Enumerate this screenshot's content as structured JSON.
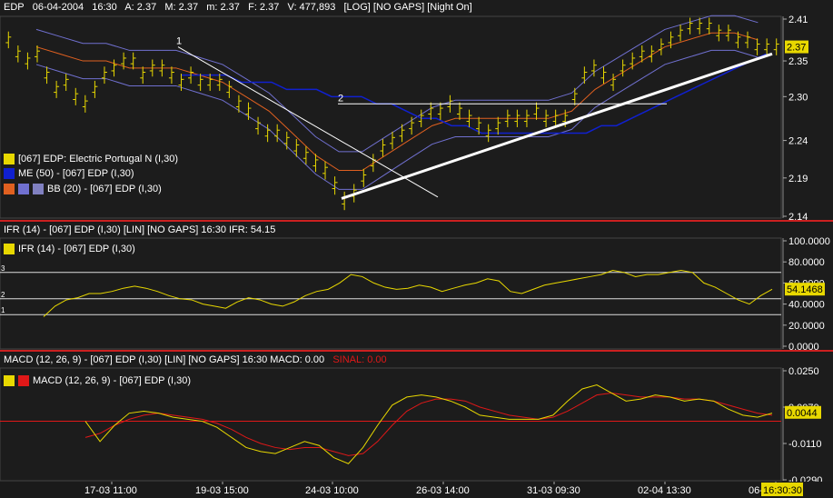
{
  "header": {
    "ticker": "EDP",
    "date": "06-04-2004",
    "time": "16:30",
    "a": "A: 2.37",
    "m": "M: 2.37",
    "min": "m: 2.37",
    "f": "F: 2.37",
    "v": "V: 477,893",
    "flags": "[LOG] [NO GAPS] [Night On]"
  },
  "price_pane": {
    "legend": [
      {
        "label": "[067] EDP: Electric Portugal N (I,30)",
        "colors": [
          "#e8d800"
        ]
      },
      {
        "label": "ME (50)  - [067] EDP (I,30)",
        "colors": [
          "#1020d0"
        ]
      },
      {
        "label": "BB (20)  - [067] EDP (I,30)",
        "colors": [
          "#e06020",
          "#7070d0",
          "#8080c0"
        ]
      }
    ],
    "trendline_labels": [
      "1",
      "2"
    ],
    "last_price_tag": "2.37"
  },
  "rsi_pane": {
    "header": "IFR (14)  - [067] EDP (I,30) [LIN] [NO GAPS]   16:30  IFR: 54.15",
    "legend": "IFR (14)  - [067] EDP (I,30)",
    "level_labels": [
      "3",
      "2",
      "1"
    ],
    "value_tag": "54.1468"
  },
  "macd_pane": {
    "header": "MACD (12, 26, 9)  - [067] EDP (I,30) [LIN] [NO GAPS]   16:30  MACD: 0.00",
    "signal_text": "SINAL: 0.00",
    "legend": "MACD (12, 26, 9)  - [067] EDP (I,30)",
    "value_tag": "0.0044"
  },
  "x_axis": {
    "labels": [
      "17-03 11:00",
      "19-03 15:00",
      "24-03 10:00",
      "26-03 14:00",
      "31-03 09:30",
      "02-04 13:30",
      "06-04"
    ],
    "current": "16:30:30"
  },
  "colors": {
    "price_bars": "#e8d800",
    "ma50": "#1020d0",
    "bb_mid": "#e06020",
    "bb_band": "#7070d0",
    "trendline": "#ffffff",
    "rsi": "#e8d800",
    "macd": "#e8d800",
    "signal": "#e01818",
    "separator": "#cc2020"
  },
  "chart_data": [
    {
      "type": "bar",
      "title": "EDP 30-minute OHLC",
      "scale": "log",
      "ylim": [
        2.14,
        2.41
      ],
      "yticks": [
        2.14,
        2.19,
        2.24,
        2.3,
        2.35,
        2.41
      ],
      "xticks": [
        "17-03 11:00",
        "19-03 15:00",
        "24-03 10:00",
        "26-03 14:00",
        "31-03 09:30",
        "02-04 13:30",
        "06-04"
      ],
      "series": [
        {
          "name": "[067] EDP: Electric Portugal N (I,30)",
          "values": [
            2.38,
            2.36,
            2.35,
            2.36,
            2.33,
            2.31,
            2.32,
            2.3,
            2.29,
            2.31,
            2.33,
            2.34,
            2.35,
            2.35,
            2.33,
            2.34,
            2.34,
            2.33,
            2.32,
            2.33,
            2.32,
            2.32,
            2.32,
            2.31,
            2.29,
            2.28,
            2.26,
            2.25,
            2.25,
            2.24,
            2.23,
            2.22,
            2.21,
            2.2,
            2.18,
            2.16,
            2.17,
            2.19,
            2.21,
            2.23,
            2.24,
            2.25,
            2.26,
            2.27,
            2.28,
            2.28,
            2.29,
            2.28,
            2.27,
            2.26,
            2.25,
            2.26,
            2.27,
            2.27,
            2.27,
            2.28,
            2.27,
            2.27,
            2.27,
            2.3,
            2.33,
            2.34,
            2.33,
            2.32,
            2.34,
            2.35,
            2.36,
            2.36,
            2.37,
            2.38,
            2.39,
            2.4,
            2.4,
            2.4,
            2.39,
            2.39,
            2.38,
            2.38,
            2.37,
            2.37,
            2.37
          ]
        },
        {
          "name": "ME (50)  - [067] EDP (I,30)",
          "values": [
            2.33,
            2.33,
            2.33,
            2.33,
            2.32,
            2.32,
            2.32,
            2.31,
            2.31,
            2.31,
            2.3,
            2.3,
            2.3,
            2.29,
            2.29,
            2.28,
            2.27,
            2.27,
            2.26,
            2.26,
            2.25,
            2.25,
            2.25,
            2.25,
            2.25,
            2.25,
            2.25,
            2.25,
            2.26,
            2.26,
            2.27,
            2.28,
            2.29,
            2.3,
            2.31,
            2.32,
            2.33,
            2.34,
            2.35,
            2.36
          ]
        },
        {
          "name": "BB (20)  - [067] EDP (I,30)",
          "values": [
            2.37,
            2.36,
            2.35,
            2.35,
            2.34,
            2.34,
            2.34,
            2.33,
            2.32,
            2.3,
            2.28,
            2.25,
            2.22,
            2.2,
            2.2,
            2.22,
            2.24,
            2.26,
            2.27,
            2.27,
            2.27,
            2.27,
            2.27,
            2.28,
            2.31,
            2.33,
            2.35,
            2.37,
            2.38,
            2.39,
            2.39,
            2.38
          ]
        }
      ],
      "annotations": [
        "1",
        "2"
      ]
    },
    {
      "type": "line",
      "title": "IFR (14)",
      "ylim": [
        0,
        100
      ],
      "yticks": [
        0,
        20,
        40,
        60,
        80,
        100
      ],
      "series": [
        {
          "name": "IFR (14)  - [067] EDP (I,30)",
          "values": [
            28,
            38,
            44,
            46,
            50,
            50,
            52,
            55,
            57,
            55,
            52,
            48,
            45,
            44,
            40,
            38,
            36,
            42,
            46,
            44,
            40,
            38,
            42,
            48,
            52,
            54,
            60,
            68,
            66,
            60,
            56,
            54,
            55,
            58,
            56,
            52,
            55,
            58,
            60,
            64,
            62,
            52,
            50,
            54,
            58,
            60,
            62,
            64,
            66,
            68,
            72,
            70,
            66,
            68,
            68,
            70,
            72,
            70,
            60,
            56,
            50,
            44,
            40,
            48,
            54
          ]
        }
      ]
    },
    {
      "type": "line",
      "title": "MACD (12, 26, 9)",
      "ylim": [
        -0.029,
        0.025
      ],
      "yticks": [
        -0.029,
        -0.011,
        0.0044,
        0.007,
        0.025
      ],
      "series": [
        {
          "name": "MACD (12, 26, 9)  - [067] EDP (I,30)",
          "values": [
            0.0,
            -0.01,
            -0.002,
            0.004,
            0.005,
            0.004,
            0.002,
            0.001,
            0.0,
            -0.003,
            -0.008,
            -0.013,
            -0.015,
            -0.016,
            -0.013,
            -0.01,
            -0.012,
            -0.018,
            -0.021,
            -0.013,
            -0.002,
            0.008,
            0.012,
            0.013,
            0.012,
            0.01,
            0.007,
            0.003,
            0.002,
            0.001,
            0.001,
            0.001,
            0.003,
            0.01,
            0.016,
            0.018,
            0.014,
            0.01,
            0.011,
            0.013,
            0.012,
            0.01,
            0.011,
            0.01,
            0.006,
            0.003,
            0.002,
            0.004
          ]
        },
        {
          "name": "SINAL",
          "values": [
            -0.008,
            -0.006,
            -0.002,
            0.001,
            0.003,
            0.004,
            0.003,
            0.002,
            0.001,
            -0.001,
            -0.004,
            -0.008,
            -0.011,
            -0.013,
            -0.014,
            -0.013,
            -0.013,
            -0.015,
            -0.017,
            -0.016,
            -0.01,
            -0.002,
            0.005,
            0.009,
            0.011,
            0.011,
            0.01,
            0.007,
            0.005,
            0.003,
            0.002,
            0.001,
            0.002,
            0.005,
            0.009,
            0.013,
            0.014,
            0.013,
            0.012,
            0.012,
            0.012,
            0.011,
            0.011,
            0.01,
            0.008,
            0.006,
            0.004,
            0.003
          ]
        }
      ]
    }
  ]
}
